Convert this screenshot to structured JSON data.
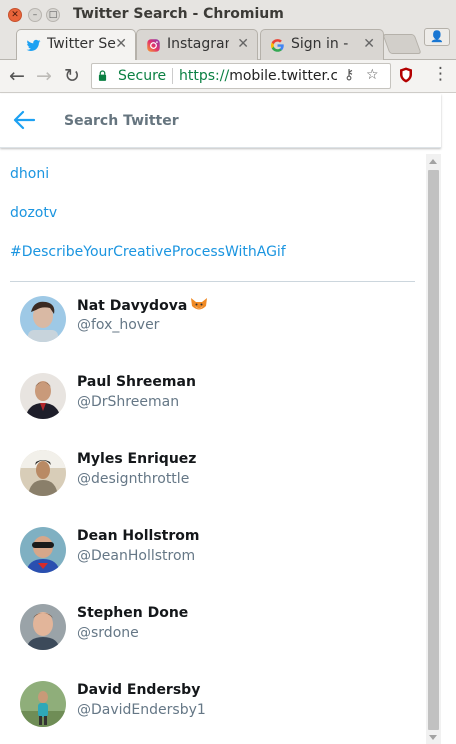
{
  "window": {
    "title": "Twitter Search - Chromium"
  },
  "tabs": [
    {
      "label": "Twitter Se",
      "icon": "twitter-icon",
      "active": true
    },
    {
      "label": "Instagram",
      "icon": "instagram-icon",
      "active": false
    },
    {
      "label": "Sign in - G",
      "icon": "google-icon",
      "active": false
    }
  ],
  "toolbar": {
    "secure_label": "Secure",
    "url_scheme": "https://",
    "url_host": "mobile.twitter.com"
  },
  "header": {
    "title": "Search Twitter"
  },
  "suggestions": [
    "dhoni",
    "dozotv",
    "#DescribeYourCreativeProcessWithAGif"
  ],
  "users": [
    {
      "name": "Nat Davydova",
      "handle": "@fox_hover",
      "emoji": "fox-emoji"
    },
    {
      "name": "Paul Shreeman",
      "handle": "@DrShreeman"
    },
    {
      "name": "Myles Enriquez",
      "handle": "@designthrottle"
    },
    {
      "name": "Dean Hollstrom",
      "handle": "@DeanHollstrom"
    },
    {
      "name": "Stephen Done",
      "handle": "@srdone"
    },
    {
      "name": "David Endersby",
      "handle": "@DavidEndersby1"
    }
  ],
  "colors": {
    "twitter_blue": "#1da1f2",
    "link_blue": "#1b95e0",
    "secure_green": "#0b8043"
  }
}
